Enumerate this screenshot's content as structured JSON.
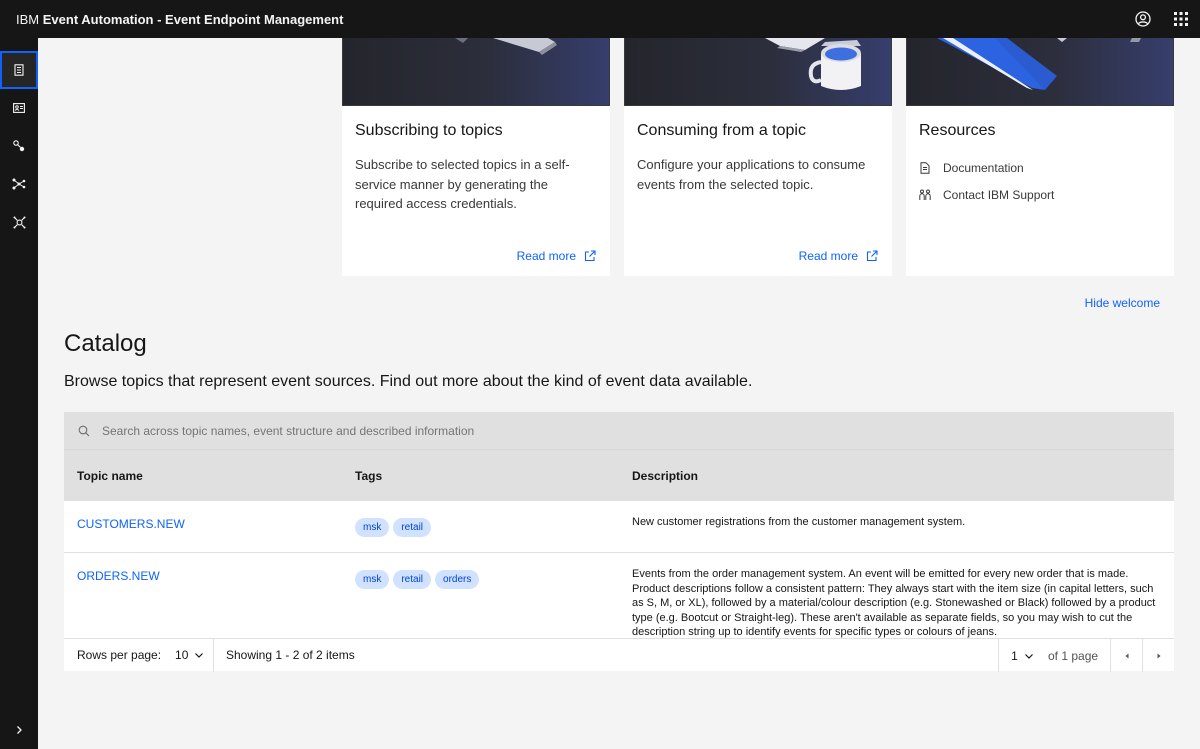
{
  "header": {
    "brand_ibm": "IBM",
    "brand_product": "Event Automation - Event Endpoint Management",
    "icons": [
      "user-avatar-icon",
      "app-switcher-icon"
    ]
  },
  "rail": {
    "items": [
      "catalog-icon",
      "subscriptions-icon",
      "gateways-icon",
      "topics-icon",
      "control-icon"
    ],
    "expand_icon": "chevron-right-icon"
  },
  "welcome": {
    "cards": [
      {
        "title": "Subscribing to topics",
        "description": "Subscribe to selected topics in a self-service manner by generating the required access credentials.",
        "link": "Read more"
      },
      {
        "title": "Consuming from a topic",
        "description": "Configure your applications to consume events from the selected topic.",
        "link": "Read more"
      },
      {
        "title": "Resources",
        "items": [
          {
            "label": "Documentation",
            "icon": "document-icon"
          },
          {
            "label": "Contact IBM Support",
            "icon": "support-icon"
          }
        ]
      }
    ],
    "hide_label": "Hide welcome"
  },
  "catalog": {
    "title": "Catalog",
    "subtitle": "Browse topics that represent event sources. Find out more about the kind of event data available."
  },
  "table": {
    "search_placeholder": "Search across topic names, event structure and described information",
    "columns": [
      "Topic name",
      "Tags",
      "Description"
    ],
    "rows": [
      {
        "name": "CUSTOMERS.NEW",
        "tags": [
          "msk",
          "retail"
        ],
        "description": "New customer registrations from the customer management system."
      },
      {
        "name": "ORDERS.NEW",
        "tags": [
          "msk",
          "retail",
          "orders"
        ],
        "description": "Events from the order management system. An event will be emitted for every new order that is made. Product descriptions follow a consistent pattern: They always start with the item size (in capital letters, such as S, M, or XL), followed by a material/colour description (e.g. Stonewashed or Black) followed by a product type (e.g. Bootcut or Straight-leg). These aren't available as separate fields, so you may wish to cut the description string up to identify events for specific types or colours of jeans."
      }
    ]
  },
  "pagination": {
    "rows_per_page_label": "Rows per page:",
    "rows_per_page_value": "10",
    "showing": "Showing 1 - 2 of 2 items",
    "page_value": "1",
    "of_pages": "of 1 page"
  },
  "colors": {
    "accent": "#0f62fe",
    "header_bg": "#161616",
    "tag_bg": "#d0e2ff"
  }
}
